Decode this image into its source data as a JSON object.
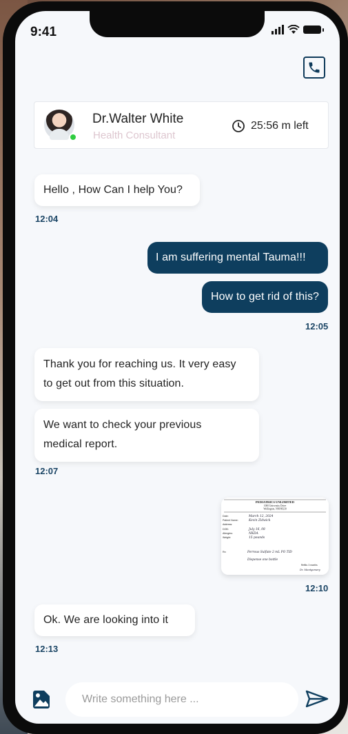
{
  "status_bar": {
    "time": "9:41"
  },
  "header": {
    "call_icon": "phone-icon"
  },
  "doctor": {
    "name": "Dr.Walter White",
    "role": "Health Consultant",
    "time_left": "25:56 m left",
    "online": true
  },
  "messages": [
    {
      "side": "in",
      "text": "Hello , How Can I help You?"
    },
    {
      "time": "12:04"
    },
    {
      "side": "out",
      "text": "I am suffering mental Tauma!!!"
    },
    {
      "side": "out",
      "text": "How to get rid of this?"
    },
    {
      "time": "12:05"
    },
    {
      "side": "in",
      "lines": [
        "Thank you for reaching us. It very easy",
        "to get out from this situation."
      ]
    },
    {
      "side": "in",
      "lines": [
        "We want to check your previous",
        "medical report."
      ]
    },
    {
      "time": "12:07"
    },
    {
      "side": "out",
      "attachment": {
        "type": "prescription-image",
        "heading": [
          "PEDIATRICS UNLIMITED",
          "1000 University Drive",
          "Wellington, NM 88230"
        ],
        "fields": [
          {
            "label": "Date:",
            "value": "March 12, 2024"
          },
          {
            "label": "Patient Name:",
            "value": "Kevin Zidwick"
          },
          {
            "label": "Address:",
            "value": ""
          },
          {
            "label": "DOB:",
            "value": "July 16, 08"
          },
          {
            "label": "Allergies:",
            "value": "NKDA"
          },
          {
            "label": "Weight:",
            "value": "15 pounds"
          }
        ],
        "rx_label": "Rx:",
        "rx_lines": [
          "Ferrous Sulfate 2 mL PO TID",
          "Dispense one bottle"
        ],
        "refills": "Refills: 3 months",
        "signature": "Dr. Montgomery"
      }
    },
    {
      "time": "12:10"
    },
    {
      "side": "in",
      "text": "Ok. We are looking into it"
    },
    {
      "time": "12:13"
    }
  ],
  "composer": {
    "placeholder": "Write something here ...",
    "attach_icon": "image-icon",
    "send_icon": "send-icon"
  },
  "colors": {
    "primary": "#0e3e5e",
    "screen_bg": "#f6f8fb",
    "role_text": "#ddc6cf",
    "online": "#2ecc40"
  }
}
